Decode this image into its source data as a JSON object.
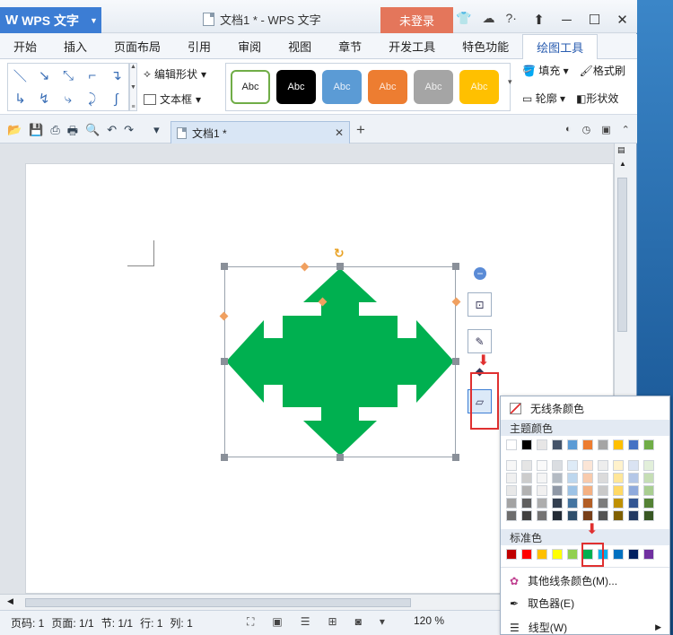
{
  "app": {
    "name": "WPS 文字",
    "doc_title": "文档1 * - WPS 文字",
    "login": "未登录"
  },
  "menu": [
    "开始",
    "插入",
    "页面布局",
    "引用",
    "审阅",
    "视图",
    "章节",
    "开发工具",
    "特色功能",
    "绘图工具"
  ],
  "ribbon": {
    "edit_shape": "编辑形状",
    "textbox": "文本框",
    "style_labels": [
      "Abc",
      "Abc",
      "Abc",
      "Abc",
      "Abc",
      "Abc"
    ],
    "style_colors": [
      "#ffffff",
      "#000000",
      "#5b9bd5",
      "#ed7d31",
      "#a5a5a5",
      "#ffc000"
    ],
    "fill": "填充",
    "format_brush": "格式刷",
    "outline": "轮廓",
    "shape_effect": "形状效"
  },
  "tab": {
    "doc_name": "文档1 *"
  },
  "status": {
    "page": "页码: 1",
    "pages": "页面: 1/1",
    "section": "节: 1/1",
    "row": "行: 1",
    "col": "列: 1",
    "zoom": "120 %"
  },
  "popup": {
    "no_line": "无线条颜色",
    "theme_header": "主题颜色",
    "standard_header": "标准色",
    "more_colors": "其他线条颜色(M)...",
    "picker": "取色器(E)",
    "line_type": "线型(W)",
    "theme_top": [
      "#ffffff",
      "#000000",
      "#e7e6e6",
      "#44546a",
      "#5b9bd5",
      "#ed7d31",
      "#a5a5a5",
      "#ffc000",
      "#4472c4",
      "#70ad47"
    ],
    "standard": [
      "#c00000",
      "#ff0000",
      "#ffc000",
      "#ffff00",
      "#92d050",
      "#00b050",
      "#00b0f0",
      "#0070c0",
      "#002060",
      "#7030a0"
    ]
  },
  "colors": {
    "shape": "#00b050",
    "accent": "#3c7dd4",
    "highlight": "#e03030"
  }
}
